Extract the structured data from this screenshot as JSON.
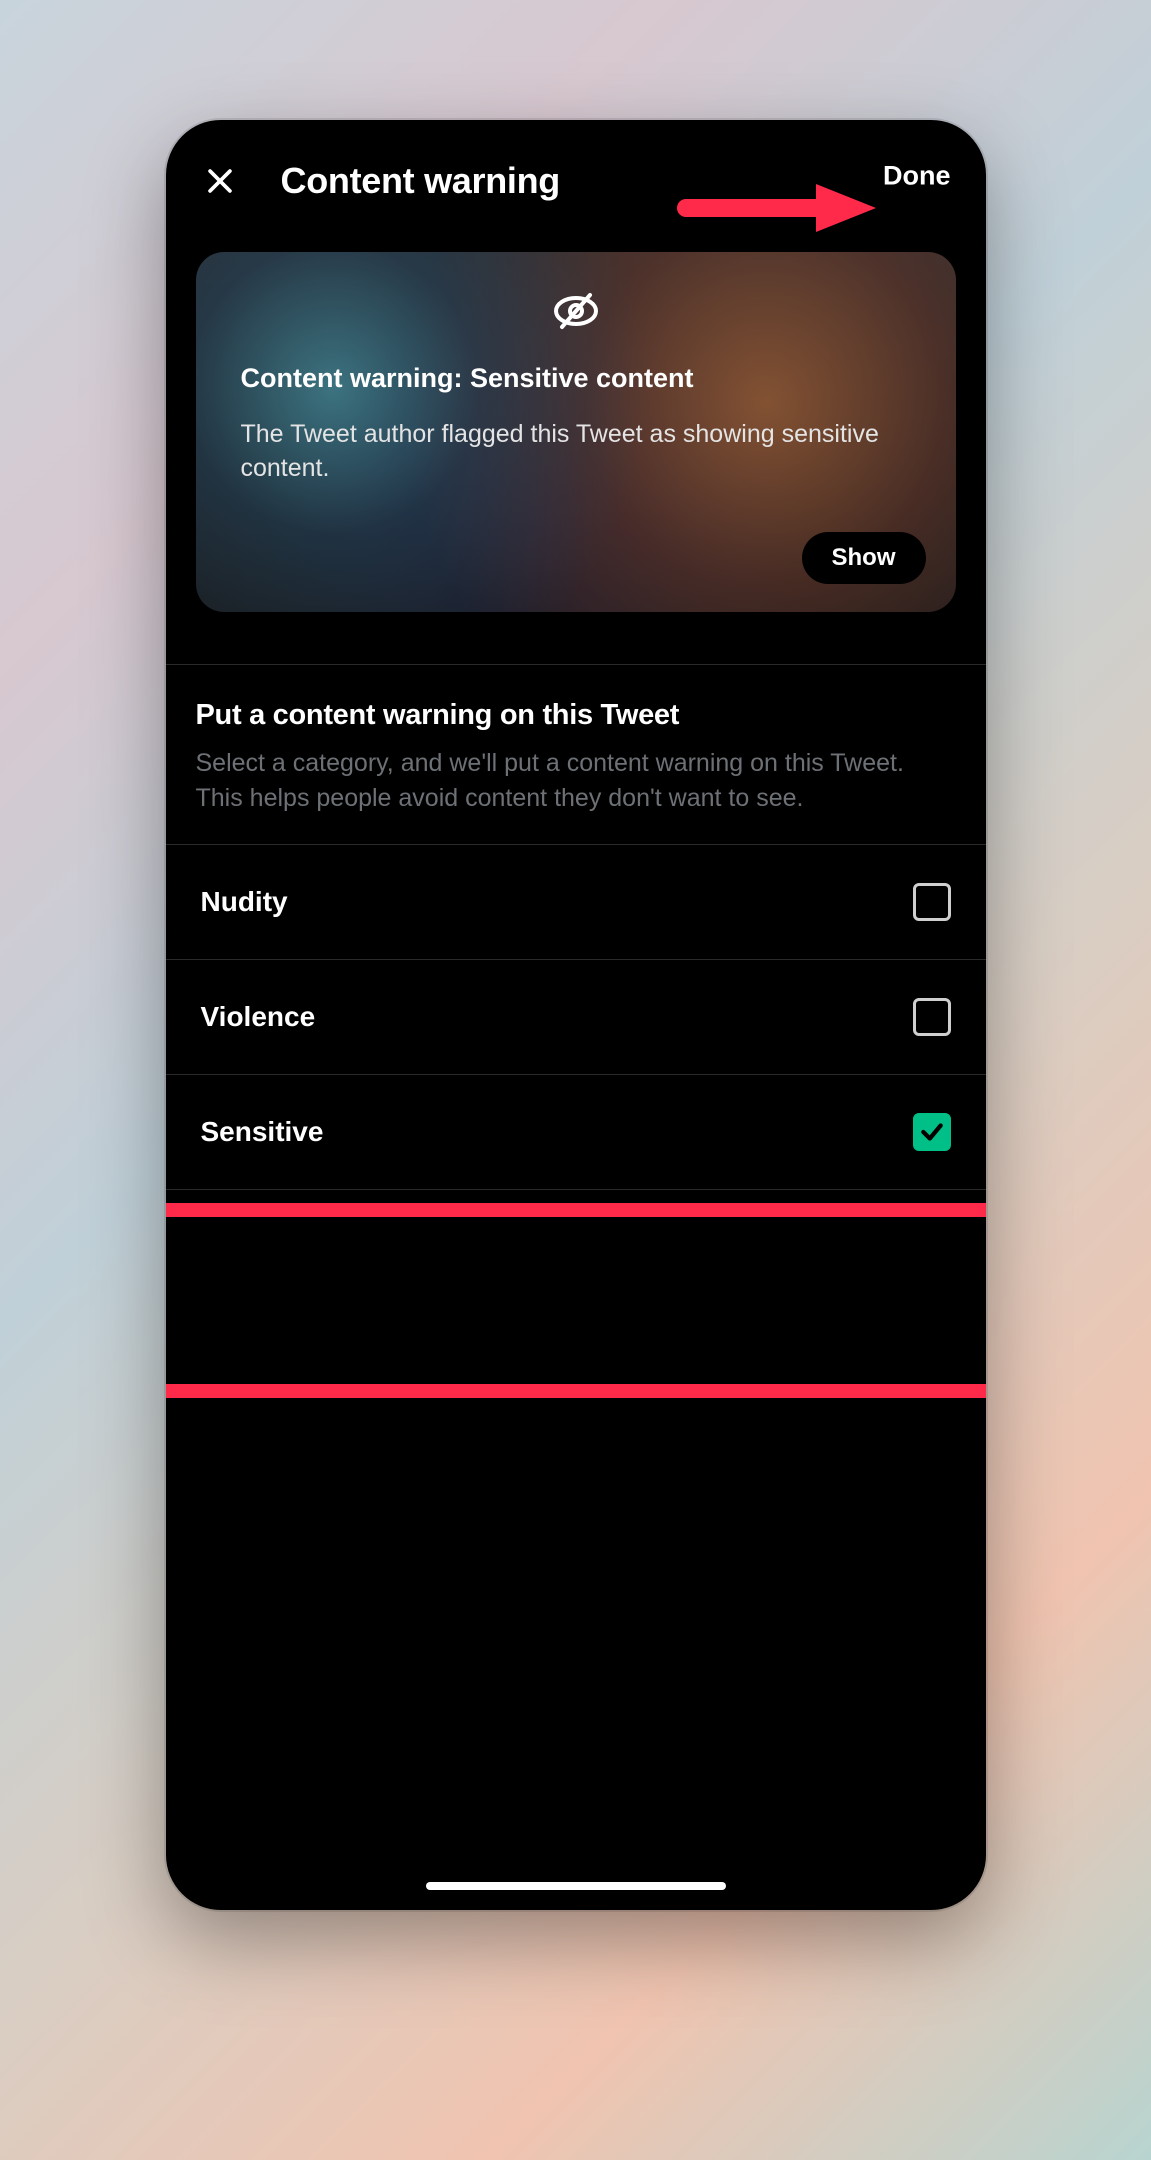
{
  "header": {
    "title": "Content warning",
    "done_label": "Done"
  },
  "preview": {
    "heading": "Content warning: Sensitive content",
    "description": "The Tweet author flagged this Tweet as showing sensitive content.",
    "show_label": "Show"
  },
  "section": {
    "title": "Put a content warning on this Tweet",
    "description": "Select a category, and we'll put a content warning on this Tweet. This helps people avoid content they don't want to see."
  },
  "options": {
    "nudity": {
      "label": "Nudity",
      "checked": false
    },
    "violence": {
      "label": "Violence",
      "checked": false
    },
    "sensitive": {
      "label": "Sensitive",
      "checked": true
    }
  },
  "annotation": {
    "highlighted_option": "sensitive",
    "arrow_color": "#ff2a4a"
  }
}
